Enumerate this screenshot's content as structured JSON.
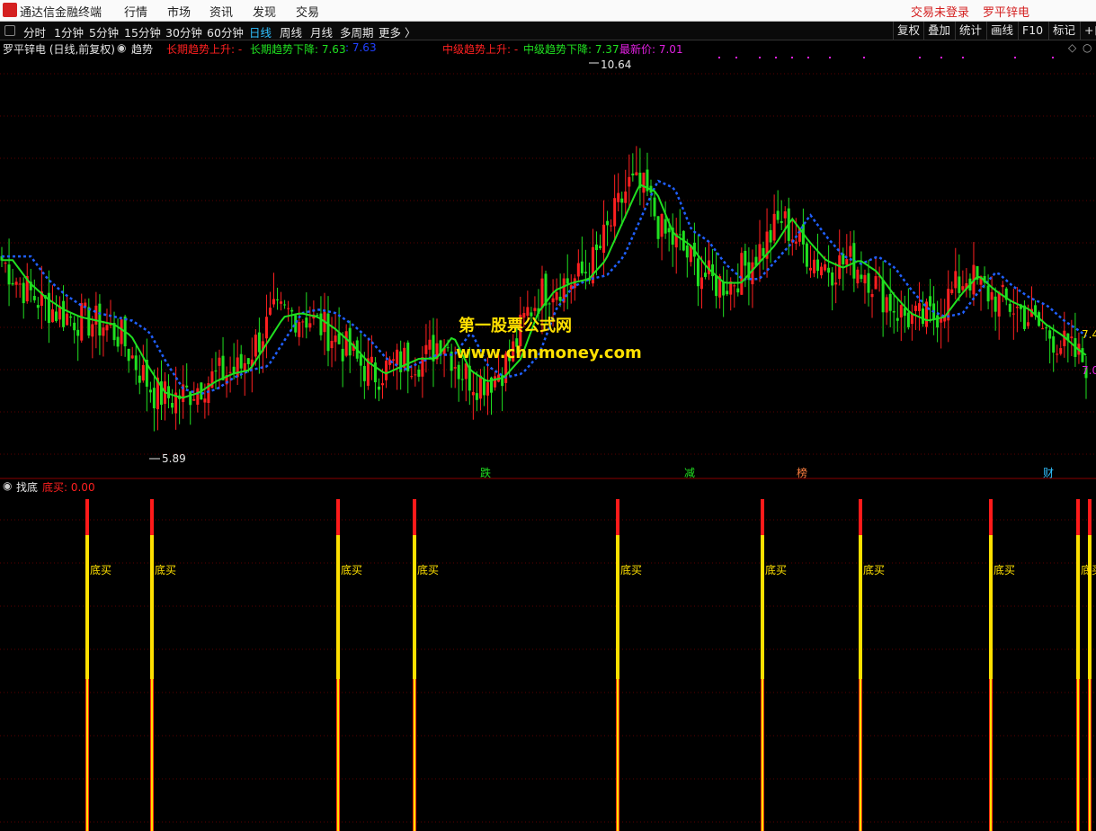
{
  "menubar": {
    "app_title": "通达信金融终端",
    "items": [
      "行情",
      "市场",
      "资讯",
      "发现",
      "交易"
    ],
    "login_status": "交易未登录",
    "stock_name": "罗平锌电"
  },
  "toolbar": {
    "periods": [
      "分时",
      "1分钟",
      "5分钟",
      "15分钟",
      "30分钟",
      "60分钟",
      "日线",
      "周线",
      "月线",
      "多周期",
      "更多 〉"
    ],
    "active_period": "日线",
    "right_buttons": [
      "复权",
      "叠加",
      "统计",
      "画线",
      "F10",
      "标记",
      "+自"
    ]
  },
  "main_panel": {
    "title": "罗平锌电 (日线,前复权)",
    "indicator": "趋势",
    "legend": [
      {
        "label": "长期趋势上升: -",
        "color": "#ff2020"
      },
      {
        "label": "长期趋势下降: 7.63",
        "color": "#20e020"
      },
      {
        "label": ": 7.63",
        "color": "#2040ff"
      },
      {
        "label": "中级趋势上升: -",
        "color": "#ff2020"
      },
      {
        "label": "中级趋势下降: 7.37",
        "color": "#20e020"
      },
      {
        "label": "最新价: 7.01",
        "color": "#e020e0"
      }
    ],
    "high_marker": "10.64",
    "low_marker": "5.89",
    "right_label_top": "7.4",
    "right_label_bottom": "7.0",
    "event_labels": [
      "跌",
      "减",
      "榜",
      "财"
    ],
    "watermark_line1": "第一股票公式网",
    "watermark_line2": "www.chnmoney.com"
  },
  "sub_panel": {
    "indicator": "找底",
    "legend": "底买: 0.00",
    "signal_label": "底买",
    "signal_count": 10
  },
  "colors": {
    "up": "#ff2020",
    "down": "#20e020",
    "long_trend_line": "#2060ff",
    "mid_trend_up": "#ff2020",
    "mid_trend_dot": "#ffe000",
    "grid": "#5a0000",
    "bg": "#000000"
  },
  "chart_data": {
    "type": "candlestick",
    "title": "罗平锌电 (日线,前复权)",
    "ylim": [
      5.5,
      11.0
    ],
    "high": 10.64,
    "low": 5.89,
    "last_price": 7.01,
    "long_trend_down": 7.63,
    "mid_trend_down": 7.37,
    "trend_path": [
      8.3,
      8.0,
      7.8,
      7.65,
      7.55,
      7.5,
      7.45,
      7.3,
      6.9,
      6.55,
      6.48,
      6.55,
      6.7,
      6.8,
      6.85,
      7.2,
      7.55,
      7.6,
      7.55,
      7.4,
      7.2,
      6.95,
      6.8,
      6.9,
      7.0,
      7.0,
      7.3,
      6.85,
      6.7,
      6.75,
      7.0,
      7.6,
      7.9,
      8.0,
      8.05,
      8.3,
      8.8,
      9.3,
      9.2,
      8.65,
      8.5,
      8.2,
      8.0,
      8.0,
      8.25,
      8.5,
      8.85,
      8.55,
      8.3,
      8.2,
      8.3,
      8.15,
      7.85,
      7.6,
      7.5,
      7.55,
      7.85,
      8.1,
      7.9,
      7.75,
      7.65,
      7.45,
      7.3,
      7.1,
      6.95
    ],
    "bottom_signals": {
      "label": "底买",
      "count": 10
    }
  }
}
